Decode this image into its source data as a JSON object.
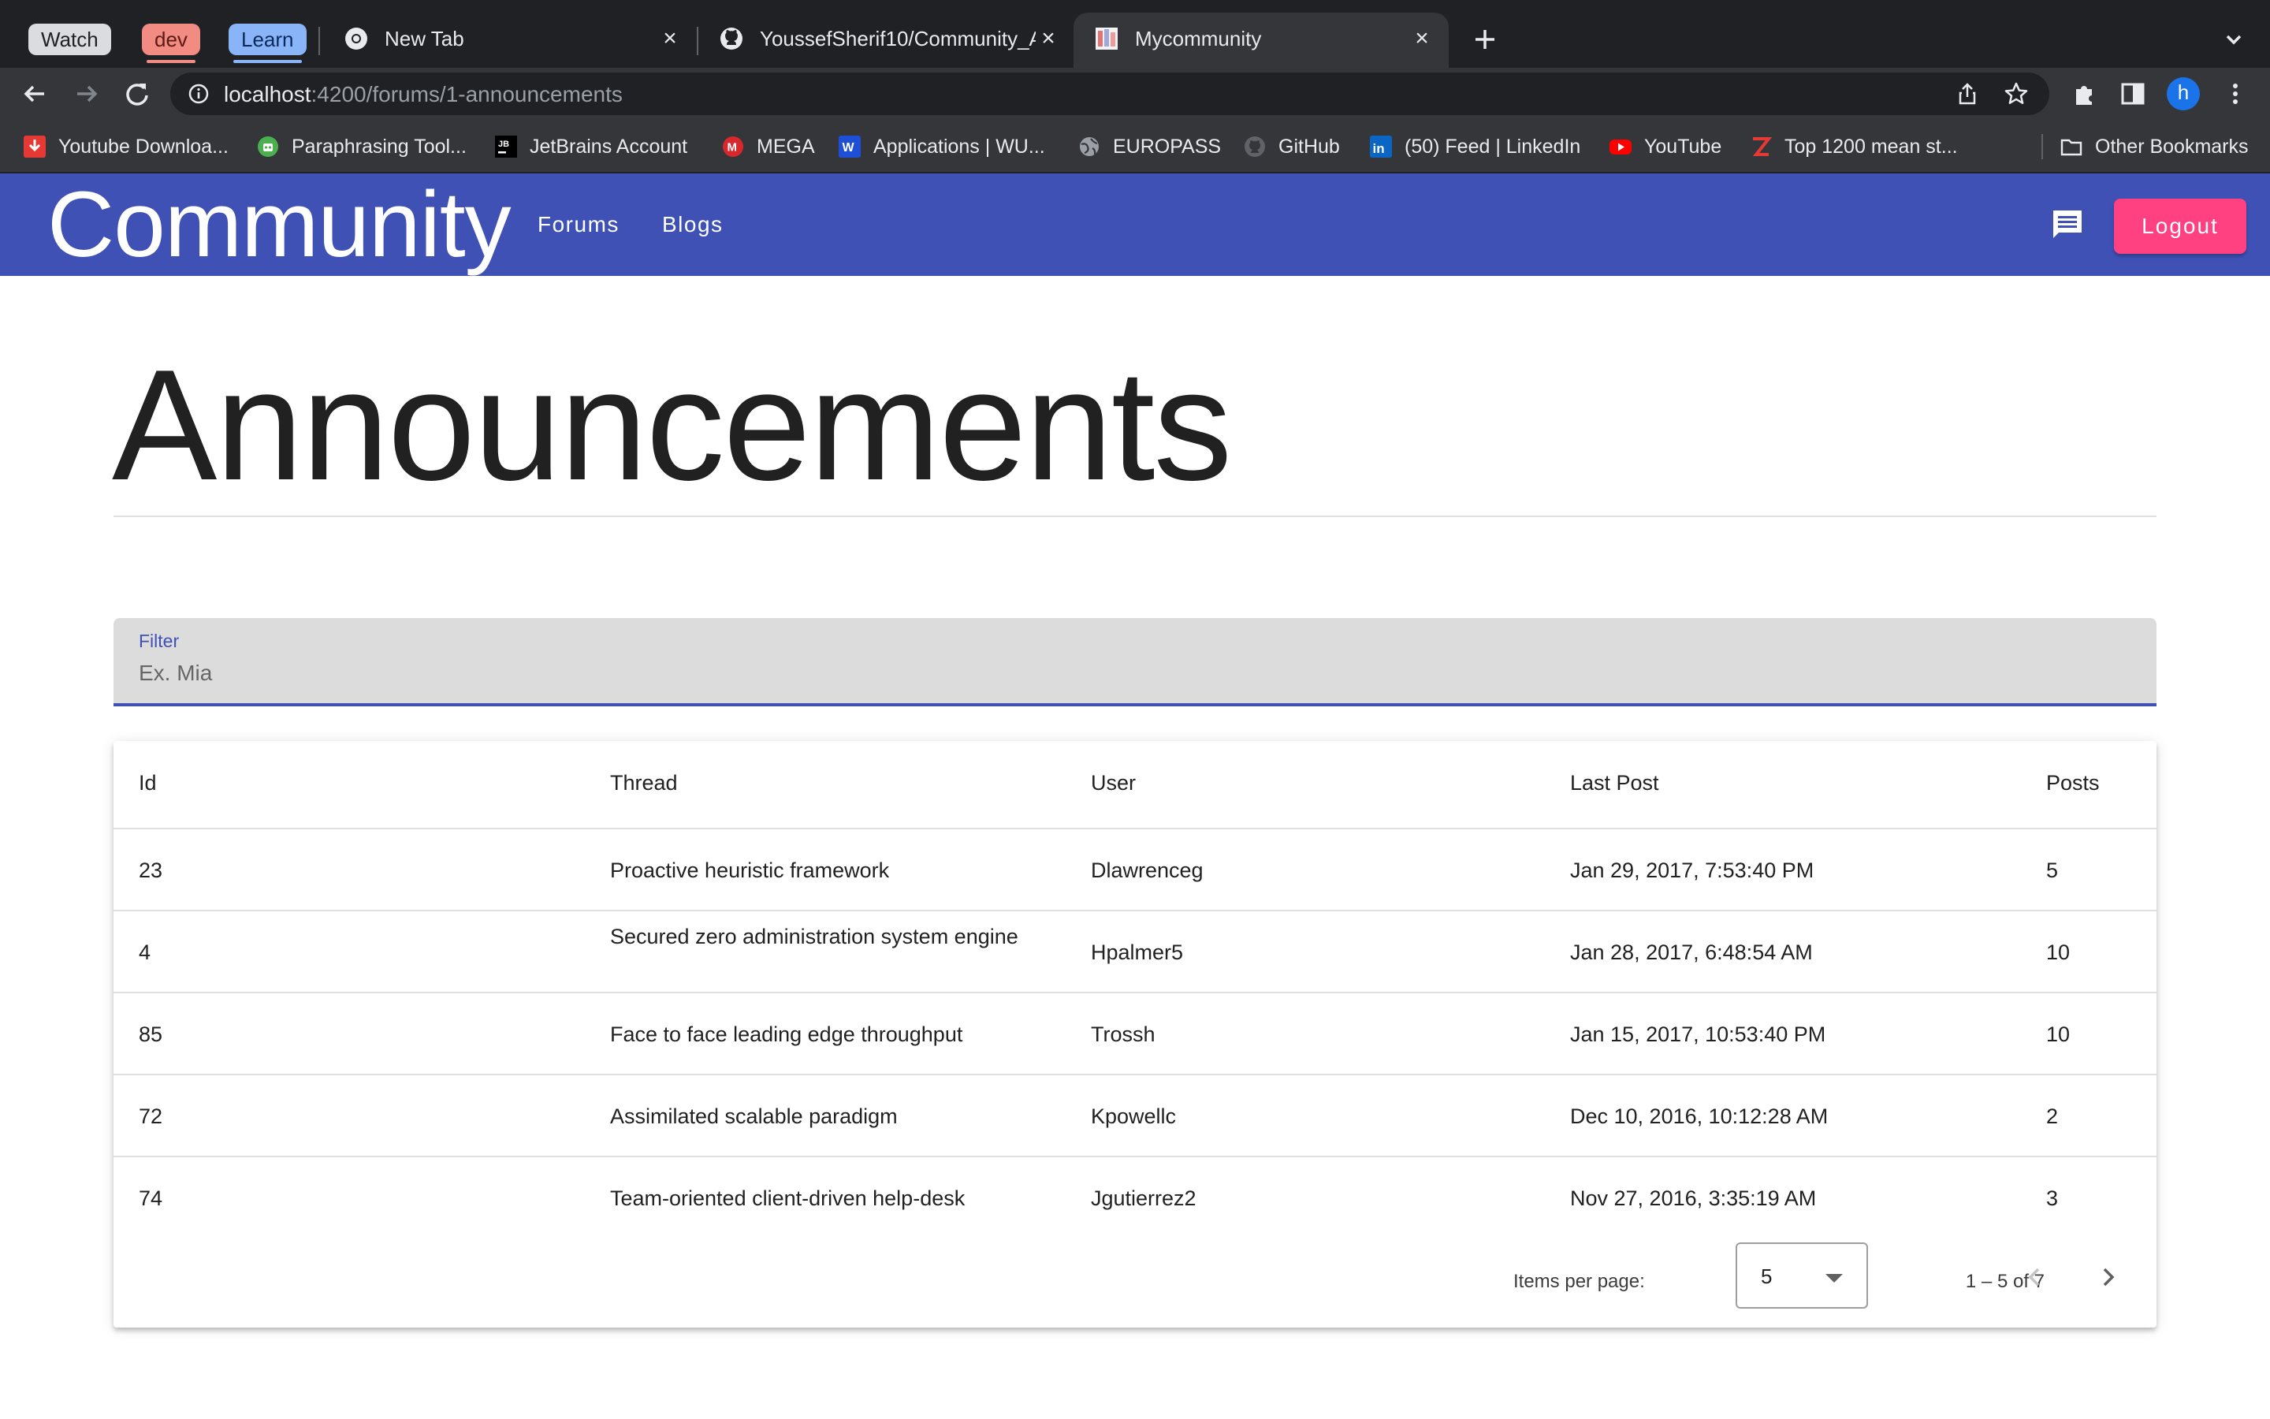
{
  "browser": {
    "tab_groups": [
      {
        "label": "Watch",
        "bg": "#dadce0",
        "fg": "#202124"
      },
      {
        "label": "dev",
        "bg": "#f28b82",
        "fg": "#5c1a14"
      },
      {
        "label": "Learn",
        "bg": "#8ab4f8",
        "fg": "#0b2a5b"
      }
    ],
    "tabs": [
      {
        "title": "New Tab",
        "icon": "chrome-icon"
      },
      {
        "title": "YoussefSherif10/Community_A",
        "icon": "github-icon"
      },
      {
        "title": "Mycommunity",
        "icon": "app-favicon",
        "active": true
      }
    ],
    "url": {
      "host": "localhost",
      "path": ":4200/forums/1-announcements"
    },
    "profile_initial": "h",
    "bookmarks": [
      {
        "label": "Youtube Downloa...",
        "icon": "download-icon",
        "color": "#e53935"
      },
      {
        "label": "Paraphrasing Tool...",
        "icon": "robot-icon",
        "color": "#4caf50"
      },
      {
        "label": "JetBrains Account",
        "icon": "jetbrains-icon",
        "color": "#000000"
      },
      {
        "label": "MEGA",
        "icon": "mega-icon",
        "color": "#d9272e"
      },
      {
        "label": "Applications | WU...",
        "icon": "w-icon",
        "color": "#1e4fd6"
      },
      {
        "label": "EUROPASS",
        "icon": "globe-icon",
        "color": "#9aa0a6"
      },
      {
        "label": "GitHub",
        "icon": "github-icon",
        "color": "#5f6368"
      },
      {
        "label": "(50) Feed | LinkedIn",
        "icon": "linkedin-icon",
        "color": "#0a66c2"
      },
      {
        "label": "YouTube",
        "icon": "youtube-icon",
        "color": "#ff0000"
      },
      {
        "label": "Top 1200 mean st...",
        "icon": "z-icon",
        "color": "#e53935"
      }
    ],
    "other_bookmarks": "Other Bookmarks"
  },
  "header": {
    "brand": "Community",
    "nav": [
      "Forums",
      "Blogs"
    ],
    "logout_label": "Logout",
    "color": "#3f51b5",
    "accent": "#ff4081"
  },
  "page": {
    "title": "Announcements"
  },
  "filter": {
    "label": "Filter",
    "placeholder": "Ex. Mia",
    "value": ""
  },
  "table": {
    "columns": [
      "Id",
      "Thread",
      "User",
      "Last Post",
      "Posts"
    ],
    "rows": [
      {
        "id": "23",
        "thread": "Proactive heuristic framework",
        "user": "Dlawrenceg",
        "last_post": "Jan 29, 2017, 7:53:40 PM",
        "posts": "5"
      },
      {
        "id": "4",
        "thread": "Secured zero administration system engine",
        "user": "Hpalmer5",
        "last_post": "Jan 28, 2017, 6:48:54 AM",
        "posts": "10"
      },
      {
        "id": "85",
        "thread": "Face to face leading edge throughput",
        "user": "Trossh",
        "last_post": "Jan 15, 2017, 10:53:40 PM",
        "posts": "10"
      },
      {
        "id": "72",
        "thread": "Assimilated scalable paradigm",
        "user": "Kpowellc",
        "last_post": "Dec 10, 2016, 10:12:28 AM",
        "posts": "2"
      },
      {
        "id": "74",
        "thread": "Team-oriented client-driven help-desk",
        "user": "Jgutierrez2",
        "last_post": "Nov 27, 2016, 3:35:19 AM",
        "posts": "3"
      }
    ]
  },
  "paginator": {
    "items_per_page_label": "Items per page:",
    "page_size": "5",
    "range_label": "1 – 5 of 7"
  }
}
